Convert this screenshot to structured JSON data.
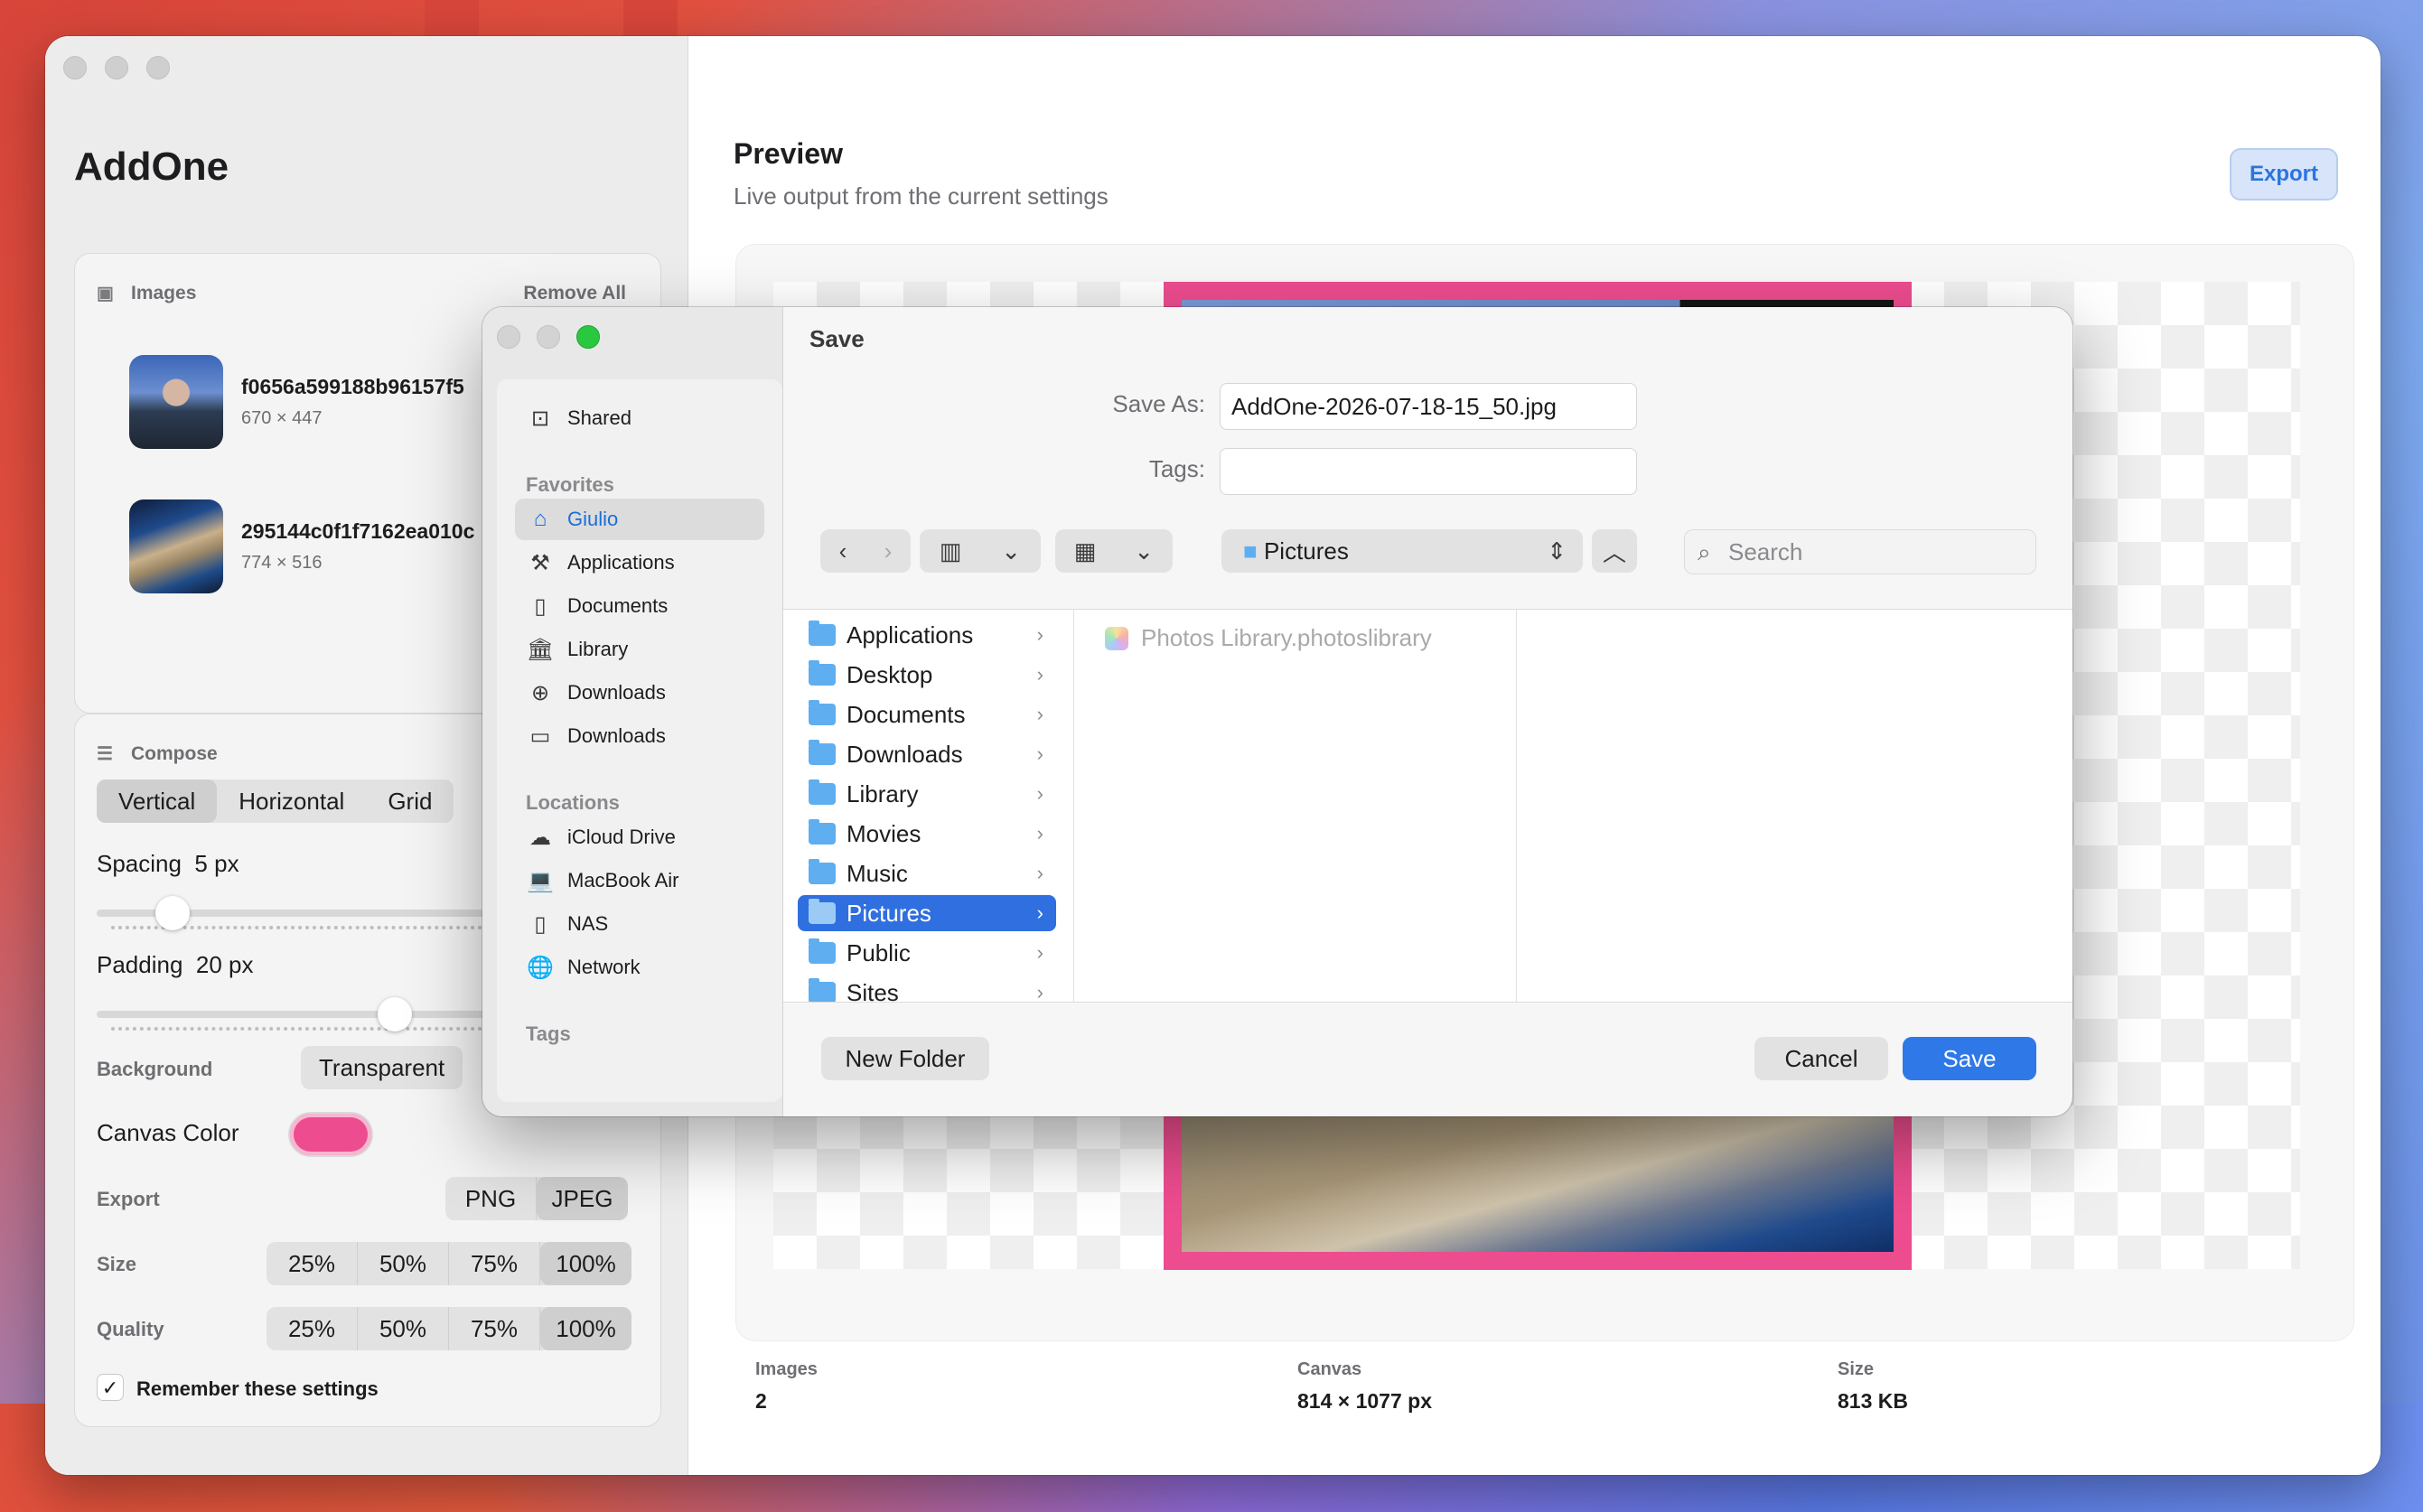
{
  "app": {
    "title": "AddOne"
  },
  "images_card": {
    "header": "Images",
    "remove_all": "Remove All",
    "items": [
      {
        "name": "f0656a599188b96157f5",
        "dims": "670 × 447"
      },
      {
        "name": "295144c0f1f7162ea010c",
        "dims": "774 × 516"
      }
    ]
  },
  "compose": {
    "header": "Compose",
    "layout_options": [
      "Vertical",
      "Horizontal",
      "Grid"
    ],
    "layout_selected": "Vertical",
    "spacing_label": "Spacing",
    "spacing_value": "5 px",
    "spacing_level": 0.14,
    "padding_label": "Padding",
    "padding_value": "20 px",
    "padding_level": 0.55,
    "background_label": "Background",
    "background_value": "Transparent",
    "canvas_color_label": "Canvas Color",
    "canvas_color": "#ed4c8e",
    "export_label": "Export",
    "export_options": [
      "PNG",
      "JPEG"
    ],
    "export_selected": "JPEG",
    "size_label": "Size",
    "size_options": [
      "25%",
      "50%",
      "75%",
      "100%"
    ],
    "size_selected": "100%",
    "quality_label": "Quality",
    "quality_options": [
      "25%",
      "50%",
      "75%",
      "100%"
    ],
    "quality_selected": "100%",
    "remember_label": "Remember these settings",
    "remember_checked": true
  },
  "preview": {
    "title": "Preview",
    "subtitle": "Live output from the current settings",
    "export_button": "Export",
    "stats": [
      {
        "label": "Images",
        "value": "2"
      },
      {
        "label": "Canvas",
        "value": "814 × 1077 px"
      },
      {
        "label": "Size",
        "value": "813 KB"
      }
    ]
  },
  "save_dialog": {
    "title": "Save",
    "save_as_label": "Save As:",
    "save_as_value": "AddOne-2026-07-18-15_50.jpg",
    "tags_label": "Tags:",
    "tags_value": "",
    "location": "Pictures",
    "search_placeholder": "Search",
    "sidebar": {
      "shared": "Shared",
      "favorites_header": "Favorites",
      "favorites": [
        {
          "label": "Giulio",
          "icon": "home-icon",
          "selected": true
        },
        {
          "label": "Applications",
          "icon": "applications-icon"
        },
        {
          "label": "Documents",
          "icon": "document-icon"
        },
        {
          "label": "Library",
          "icon": "library-icon"
        },
        {
          "label": "Downloads",
          "icon": "download-icon"
        },
        {
          "label": "Downloads",
          "icon": "folder-icon"
        }
      ],
      "locations_header": "Locations",
      "locations": [
        {
          "label": "iCloud Drive",
          "icon": "cloud-icon"
        },
        {
          "label": "MacBook Air",
          "icon": "laptop-icon"
        },
        {
          "label": "NAS",
          "icon": "document-icon"
        },
        {
          "label": "Network",
          "icon": "globe-icon"
        }
      ],
      "tags_header": "Tags"
    },
    "folders": [
      "Applications",
      "Desktop",
      "Documents",
      "Downloads",
      "Library",
      "Movies",
      "Music",
      "Pictures",
      "Public",
      "Sites"
    ],
    "selected_folder": "Pictures",
    "column2_items": [
      "Photos Library.photoslibrary"
    ],
    "new_folder": "New Folder",
    "cancel": "Cancel",
    "save": "Save"
  }
}
